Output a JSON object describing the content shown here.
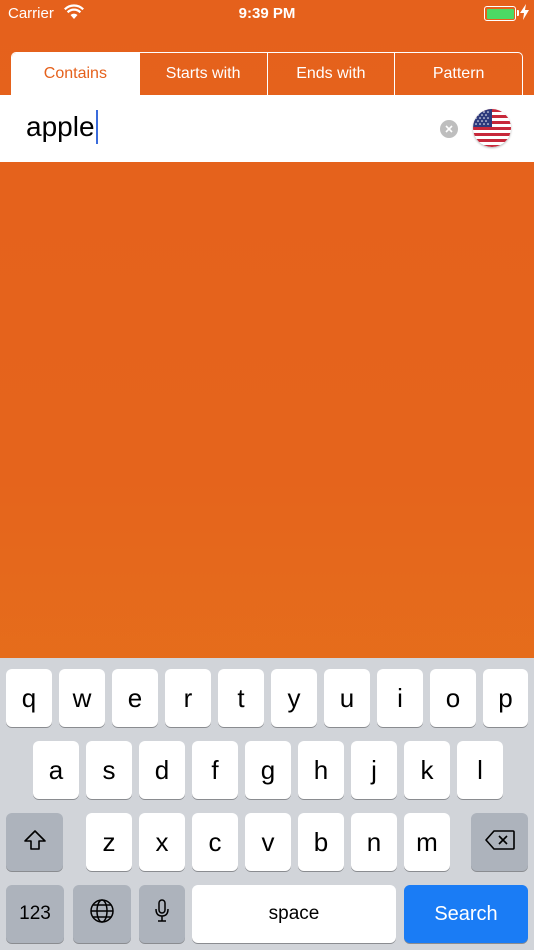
{
  "status_bar": {
    "carrier": "Carrier",
    "time": "9:39 PM"
  },
  "tabs": [
    {
      "label": "Contains",
      "active": true
    },
    {
      "label": "Starts with",
      "active": false
    },
    {
      "label": "Ends with",
      "active": false
    },
    {
      "label": "Pattern",
      "active": false
    }
  ],
  "search": {
    "value": "apple",
    "language_flag": "us-flag-icon"
  },
  "colors": {
    "accent": "#E5611C",
    "search_key": "#1A7CF5",
    "keyboard_bg": "#D1D4D9"
  },
  "keyboard": {
    "row1": [
      "q",
      "w",
      "e",
      "r",
      "t",
      "y",
      "u",
      "i",
      "o",
      "p"
    ],
    "row2": [
      "a",
      "s",
      "d",
      "f",
      "g",
      "h",
      "j",
      "k",
      "l"
    ],
    "row3": [
      "z",
      "x",
      "c",
      "v",
      "b",
      "n",
      "m"
    ],
    "numbers_label": "123",
    "space_label": "space",
    "search_label": "Search"
  }
}
